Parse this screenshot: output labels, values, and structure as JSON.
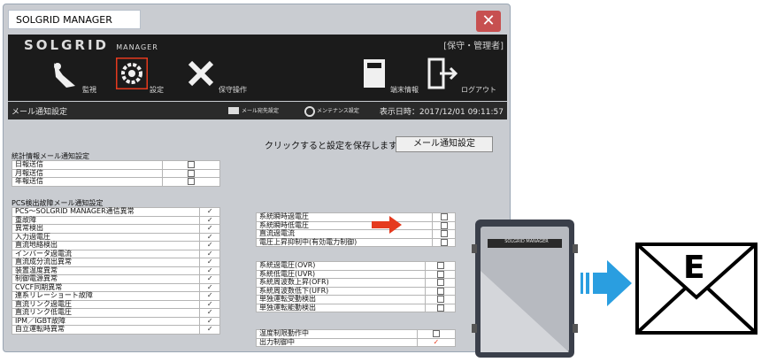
{
  "window": {
    "title": "SOLGRID MANAGER",
    "close_label": "✕"
  },
  "header": {
    "brand": "SOLGRID",
    "brand_sub": "MANAGER",
    "role": "[保守・管理者]",
    "nav": [
      {
        "label": "監視",
        "icon": "monitor-broom-icon"
      },
      {
        "label": "設定",
        "icon": "gear-icon"
      },
      {
        "label": "保守操作",
        "icon": "wrench-screwdriver-icon"
      },
      {
        "label": "端末情報",
        "icon": "terminal-cabinet-icon"
      },
      {
        "label": "ログアウト",
        "icon": "logout-door-icon"
      }
    ]
  },
  "subbar": {
    "title": "メール通知設定",
    "sub1": "メール宛先設定",
    "sub2": "メンテナンス設定",
    "datetime": "表示日時：2017/12/01 09:11:57"
  },
  "content": {
    "save_hint": "クリックすると設定を保存します",
    "save_button": "メール通知設定",
    "stat_title": "統計情報メール通知設定",
    "stat_rows": [
      {
        "label": "日報送信",
        "checked": false
      },
      {
        "label": "月報送信",
        "checked": false
      },
      {
        "label": "年報送信",
        "checked": false
      }
    ],
    "pcs_title": "PCS検出故障メール通知設定",
    "pcs_rows": [
      {
        "label": "PCS～SOLGRID MANAGER通信異常",
        "checked": true
      },
      {
        "label": "重故障",
        "checked": true
      },
      {
        "label": "異常検出",
        "checked": true
      },
      {
        "label": "入力過電圧",
        "checked": true
      },
      {
        "label": "直流地絡検出",
        "checked": true
      },
      {
        "label": "インバータ過電流",
        "checked": true
      },
      {
        "label": "直流成分流出異常",
        "checked": true
      },
      {
        "label": "装置温度異常",
        "checked": true
      },
      {
        "label": "制御電源異常",
        "checked": true
      },
      {
        "label": "CVCF同期異常",
        "checked": true
      },
      {
        "label": "連系リレーショート故障",
        "checked": true
      },
      {
        "label": "直流リンク過電圧",
        "checked": true
      },
      {
        "label": "直流リンク低電圧",
        "checked": true
      },
      {
        "label": "IPM／IGBT故障",
        "checked": true
      },
      {
        "label": "自立運転時異常",
        "checked": true
      }
    ],
    "grid_group1": [
      {
        "label": "系統瞬時過電圧",
        "checked": false
      },
      {
        "label": "系統瞬時低電圧",
        "checked": false
      },
      {
        "label": "直流過電流",
        "checked": false
      },
      {
        "label": "電圧上昇抑制中(有効電力制御)",
        "checked": false
      }
    ],
    "grid_group2": [
      {
        "label": "系統過電圧(OVR)",
        "checked": false
      },
      {
        "label": "系統低電圧(UVR)",
        "checked": false
      },
      {
        "label": "系統周波数上昇(OFR)",
        "checked": false
      },
      {
        "label": "系統周波数低下(UFR)",
        "checked": false
      },
      {
        "label": "単独運転受動検出",
        "checked": false
      },
      {
        "label": "単独運転能動検出",
        "checked": false
      }
    ],
    "grid_group3": [
      {
        "label": "温度制限動作中",
        "checked": false
      },
      {
        "label": "出力制御中",
        "checked": true
      }
    ]
  },
  "device": {
    "label": "SOLGRID MANAGER"
  },
  "mail": {
    "letter": "E"
  },
  "colors": {
    "header_bg": "#1b1b1b",
    "content_bg": "#c9ccd1",
    "accent_red": "#e53a1e",
    "arrow_blue": "#2a9ee0"
  }
}
